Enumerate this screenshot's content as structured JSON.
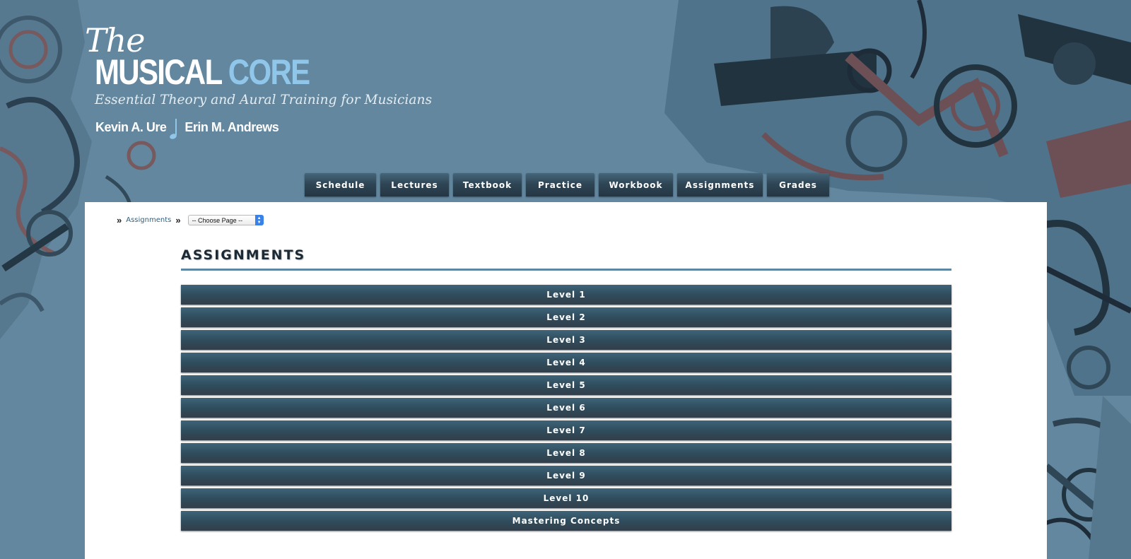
{
  "brand": {
    "the": "The",
    "musical": "MUSICAL",
    "core": "CORE",
    "tagline": "Essential Theory and Aural Training for Musicians",
    "author1": "Kevin A. Ure",
    "author2": "Erin M. Andrews"
  },
  "nav": {
    "tabs": [
      {
        "label": "Schedule"
      },
      {
        "label": "Lectures"
      },
      {
        "label": "Textbook"
      },
      {
        "label": "Practice"
      },
      {
        "label": "Workbook"
      },
      {
        "label": "Assignments"
      },
      {
        "label": "Grades"
      }
    ]
  },
  "breadcrumb": {
    "link": "Assignments",
    "select_value": "-- Choose Page --"
  },
  "page": {
    "title": "ASSIGNMENTS"
  },
  "levels": [
    {
      "label": "Level 1"
    },
    {
      "label": "Level 2"
    },
    {
      "label": "Level 3"
    },
    {
      "label": "Level 4"
    },
    {
      "label": "Level 5"
    },
    {
      "label": "Level 6"
    },
    {
      "label": "Level 7"
    },
    {
      "label": "Level 8"
    },
    {
      "label": "Level 9"
    },
    {
      "label": "Level 10"
    },
    {
      "label": "Mastering Concepts"
    }
  ],
  "colors": {
    "page_bg": "#62879f",
    "accent_light_blue": "#8fc6ea",
    "button_dark": "#2f4d5e",
    "rule": "#5c86a2"
  }
}
